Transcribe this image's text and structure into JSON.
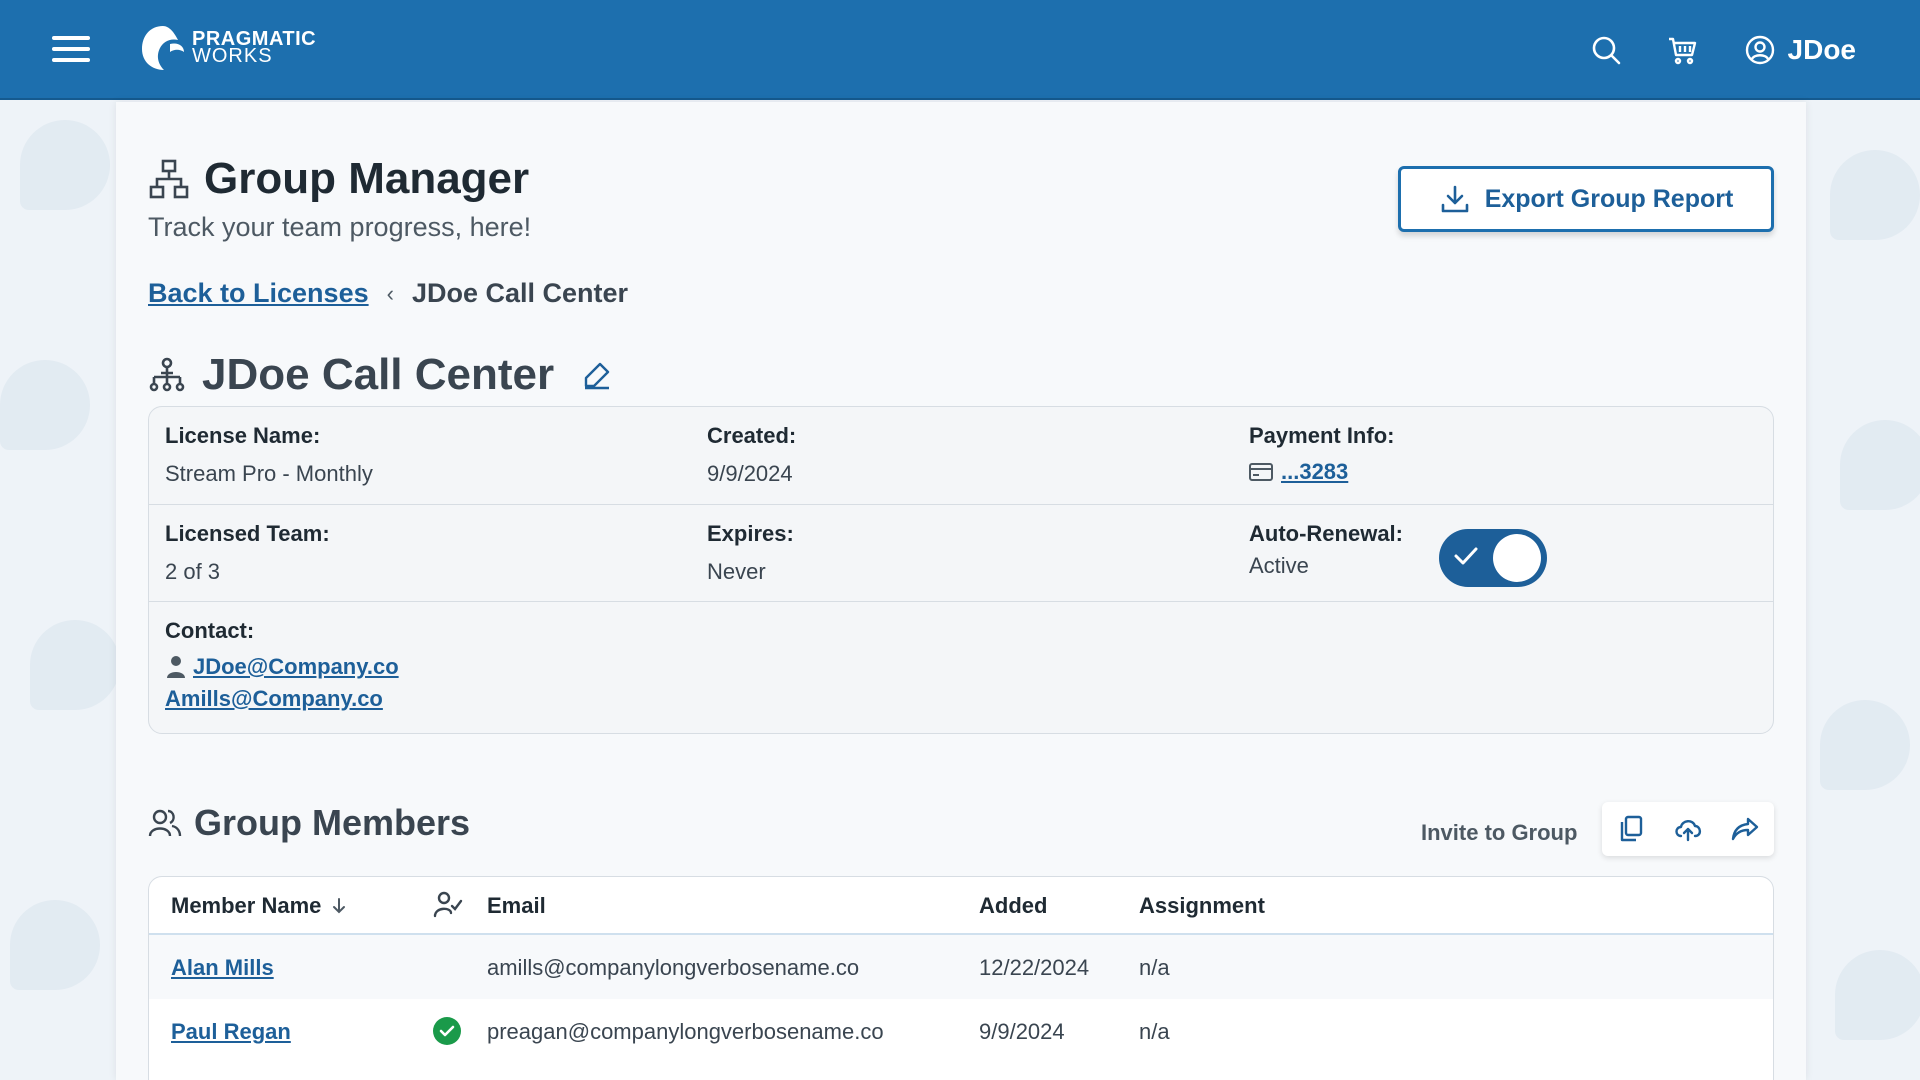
{
  "header": {
    "logo_line1": "PRAGMATIC",
    "logo_line2": "WORKS",
    "user_name": "JDoe"
  },
  "page": {
    "title": "Group Manager",
    "subtitle": "Track your team progress, here!",
    "export_label": "Export Group Report"
  },
  "breadcrumb": {
    "back_label": "Back to Licenses",
    "current": "JDoe Call Center"
  },
  "group": {
    "name": "JDoe Call Center",
    "license_name_label": "License Name:",
    "license_name": "Stream Pro - Monthly",
    "created_label": "Created:",
    "created": "9/9/2024",
    "payment_label": "Payment Info:",
    "payment": "...3283",
    "licensed_team_label": "Licensed Team:",
    "licensed_team": "2 of 3",
    "expires_label": "Expires:",
    "expires": "Never",
    "auto_renewal_label": "Auto-Renewal:",
    "auto_renewal": "Active",
    "contact_label": "Contact:",
    "contacts": [
      "JDoe@Company.co",
      "Amills@Company.co"
    ]
  },
  "members": {
    "title": "Group Members",
    "invite_label": "Invite to Group",
    "columns": {
      "name": "Member Name",
      "email": "Email",
      "added": "Added",
      "assignment": "Assignment"
    },
    "rows": [
      {
        "name": "Alan Mills",
        "email": "amills@companylongverbosename.co",
        "added": "12/22/2024",
        "assignment": "n/a"
      },
      {
        "name": "Paul Regan",
        "email": "preagan@companylongverbosename.co",
        "added": "9/9/2024",
        "assignment": "n/a"
      }
    ]
  },
  "colors": {
    "brand": "#1d6fae",
    "link": "#1d5f99",
    "success": "#1a9a4a"
  }
}
